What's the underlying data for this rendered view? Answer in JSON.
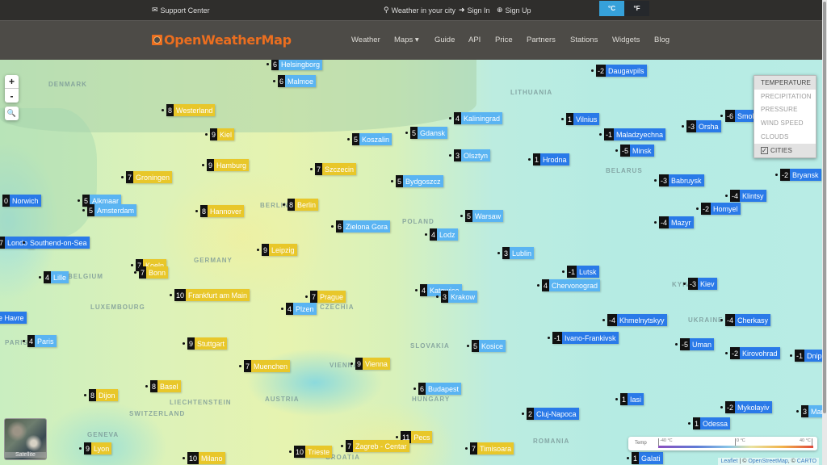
{
  "topbar": {
    "support": {
      "icon": "envelope-icon",
      "label": "Support Center"
    },
    "weather_city": {
      "icon": "search-icon",
      "label": "Weather in your city"
    },
    "sign_in": {
      "icon": "sign-in-icon",
      "label": "Sign In"
    },
    "sign_up": {
      "icon": "plus-circle-icon",
      "label": "Sign Up"
    },
    "units": {
      "celsius": "°C",
      "fahrenheit": "°F",
      "active": "celsius"
    }
  },
  "navbar": {
    "logo": "OpenWeatherMap",
    "links": [
      "Weather",
      "Maps ▾",
      "Guide",
      "API",
      "Price",
      "Partners",
      "Stations",
      "Widgets",
      "Blog"
    ]
  },
  "map": {
    "zoom_in": "+",
    "zoom_out": "-",
    "search_icon": "search-icon",
    "layers": [
      {
        "label": "TEMPERATURE",
        "active": true
      },
      {
        "label": "PRECIPITATION",
        "active": false
      },
      {
        "label": "PRESSURE",
        "active": false
      },
      {
        "label": "WIND SPEED",
        "active": false
      },
      {
        "label": "CLOUDS",
        "active": false
      },
      {
        "label": "CITIES",
        "active": true,
        "checkbox": true
      }
    ],
    "satellite_label": "Satellite",
    "legend": {
      "title": "Temp",
      "min": "-40 °C",
      "mid": "0 °C",
      "max": "40 °C"
    },
    "attribution": {
      "leaflet": "Leaflet",
      "sep": " | © ",
      "osm": "OpenStreetMap",
      "sep2": ", © ",
      "carto": "CARTO"
    },
    "countries": [
      "DENMARK",
      "LITHUANIA",
      "BELARUS",
      "POLAND",
      "GERMANY",
      "BELGIUM",
      "LUXEMBOURG",
      "CZECHIA",
      "SLOVAKIA",
      "AUSTRIA",
      "UKRAINE",
      "HUNGARY",
      "SWITZERLAND",
      "LIECHTENSTEIN",
      "ROMANIA",
      "CROATIA",
      "PARIS",
      "VIENNA",
      "KYIV",
      "BERLIN",
      "GENEVA"
    ],
    "cities": [
      {
        "name": "Helsingborg",
        "temp": "6",
        "color": "lblue"
      },
      {
        "name": "Malmoe",
        "temp": "6",
        "color": "lblue"
      },
      {
        "name": "Daugavpils",
        "temp": "-2",
        "color": "blue"
      },
      {
        "name": "Westerland",
        "temp": "8",
        "color": "yellow"
      },
      {
        "name": "Kaliningrad",
        "temp": "4",
        "color": "lblue"
      },
      {
        "name": "Vilnius",
        "temp": "1",
        "color": "blue"
      },
      {
        "name": "Smolensk",
        "temp": "-6",
        "color": "blue"
      },
      {
        "name": "Orsha",
        "temp": "-3",
        "color": "blue"
      },
      {
        "name": "Kiel",
        "temp": "9",
        "color": "yellow"
      },
      {
        "name": "Gdansk",
        "temp": "5",
        "color": "lblue"
      },
      {
        "name": "Maladzyechna",
        "temp": "-1",
        "color": "blue"
      },
      {
        "name": "Koszalin",
        "temp": "5",
        "color": "lblue"
      },
      {
        "name": "Minsk",
        "temp": "-5",
        "color": "blue"
      },
      {
        "name": "Olsztyn",
        "temp": "3",
        "color": "lblue"
      },
      {
        "name": "Hrodna",
        "temp": "1",
        "color": "blue"
      },
      {
        "name": "Hamburg",
        "temp": "9",
        "color": "yellow"
      },
      {
        "name": "Szczecin",
        "temp": "7",
        "color": "yellow"
      },
      {
        "name": "Groningen",
        "temp": "7",
        "color": "yellow"
      },
      {
        "name": "Bydgoszcz",
        "temp": "5",
        "color": "lblue"
      },
      {
        "name": "Babruysk",
        "temp": "-3",
        "color": "blue"
      },
      {
        "name": "Bryansk",
        "temp": "-2",
        "color": "blue"
      },
      {
        "name": "Norwich",
        "temp": "0",
        "color": "blue"
      },
      {
        "name": "Alkmaar",
        "temp": "5",
        "color": "lblue"
      },
      {
        "name": "Klintsy",
        "temp": "-4",
        "color": "blue"
      },
      {
        "name": "Berlin",
        "temp": "8",
        "color": "yellow"
      },
      {
        "name": "Amsterdam",
        "temp": "5",
        "color": "lblue"
      },
      {
        "name": "Hannover",
        "temp": "8",
        "color": "yellow"
      },
      {
        "name": "Homyel",
        "temp": "-2",
        "color": "blue"
      },
      {
        "name": "Warsaw",
        "temp": "5",
        "color": "lblue"
      },
      {
        "name": "Mazyr",
        "temp": "-4",
        "color": "blue"
      },
      {
        "name": "Zielona Gora",
        "temp": "6",
        "color": "lblue"
      },
      {
        "name": "Lodz",
        "temp": "4",
        "color": "lblue"
      },
      {
        "name": "London",
        "temp": "7",
        "color": "blue"
      },
      {
        "name": "Southend-on-Sea",
        "temp": "",
        "color": "blue"
      },
      {
        "name": "Leipzig",
        "temp": "9",
        "color": "yellow"
      },
      {
        "name": "Lublin",
        "temp": "3",
        "color": "lblue"
      },
      {
        "name": "Koeln",
        "temp": "7",
        "color": "yellow"
      },
      {
        "name": "Bonn",
        "temp": "7",
        "color": "yellow"
      },
      {
        "name": "Lutsk",
        "temp": "-1",
        "color": "blue"
      },
      {
        "name": "Lille",
        "temp": "4",
        "color": "lblue"
      },
      {
        "name": "Kiev",
        "temp": "-3",
        "color": "blue"
      },
      {
        "name": "Chervonograd",
        "temp": "4",
        "color": "lblue"
      },
      {
        "name": "Katowice",
        "temp": "4",
        "color": "lblue"
      },
      {
        "name": "Frankfurt am Main",
        "temp": "10",
        "color": "yellow"
      },
      {
        "name": "Prague",
        "temp": "7",
        "color": "yellow"
      },
      {
        "name": "Krakow",
        "temp": "3",
        "color": "lblue"
      },
      {
        "name": "Plzen",
        "temp": "4",
        "color": "lblue"
      },
      {
        "name": "Le Havre",
        "temp": "",
        "color": "blue"
      },
      {
        "name": "Khmelnytskyy",
        "temp": "-4",
        "color": "blue"
      },
      {
        "name": "Cherkasy",
        "temp": "-4",
        "color": "blue"
      },
      {
        "name": "Ivano-Frankivsk",
        "temp": "-1",
        "color": "blue"
      },
      {
        "name": "Paris",
        "temp": "4",
        "color": "lblue"
      },
      {
        "name": "Stuttgart",
        "temp": "9",
        "color": "yellow"
      },
      {
        "name": "Kosice",
        "temp": "5",
        "color": "lblue"
      },
      {
        "name": "Uman",
        "temp": "-5",
        "color": "blue"
      },
      {
        "name": "Kirovohrad",
        "temp": "-2",
        "color": "blue"
      },
      {
        "name": "Dnipro",
        "temp": "-1",
        "color": "blue"
      },
      {
        "name": "Vienna",
        "temp": "9",
        "color": "yellow"
      },
      {
        "name": "Muenchen",
        "temp": "7",
        "color": "yellow"
      },
      {
        "name": "Basel",
        "temp": "8",
        "color": "yellow"
      },
      {
        "name": "Budapest",
        "temp": "6",
        "color": "lblue"
      },
      {
        "name": "Dijon",
        "temp": "8",
        "color": "yellow"
      },
      {
        "name": "Iasi",
        "temp": "1",
        "color": "blue"
      },
      {
        "name": "Mykolayiv",
        "temp": "-2",
        "color": "blue"
      },
      {
        "name": "Mariupol",
        "temp": "3",
        "color": "lblue"
      },
      {
        "name": "Cluj-Napoca",
        "temp": "2",
        "color": "blue"
      },
      {
        "name": "Odessa",
        "temp": "1",
        "color": "blue"
      },
      {
        "name": "Pecs",
        "temp": "11",
        "color": "yellow"
      },
      {
        "name": "Lyon",
        "temp": "9",
        "color": "yellow"
      },
      {
        "name": "Zagreb - Centar",
        "temp": "7",
        "color": "yellow"
      },
      {
        "name": "Timisoara",
        "temp": "7",
        "color": "yellow"
      },
      {
        "name": "Trieste",
        "temp": "10",
        "color": "yellow"
      },
      {
        "name": "Milano",
        "temp": "10",
        "color": "yellow"
      },
      {
        "name": "Galati",
        "temp": "1",
        "color": "blue"
      }
    ]
  }
}
